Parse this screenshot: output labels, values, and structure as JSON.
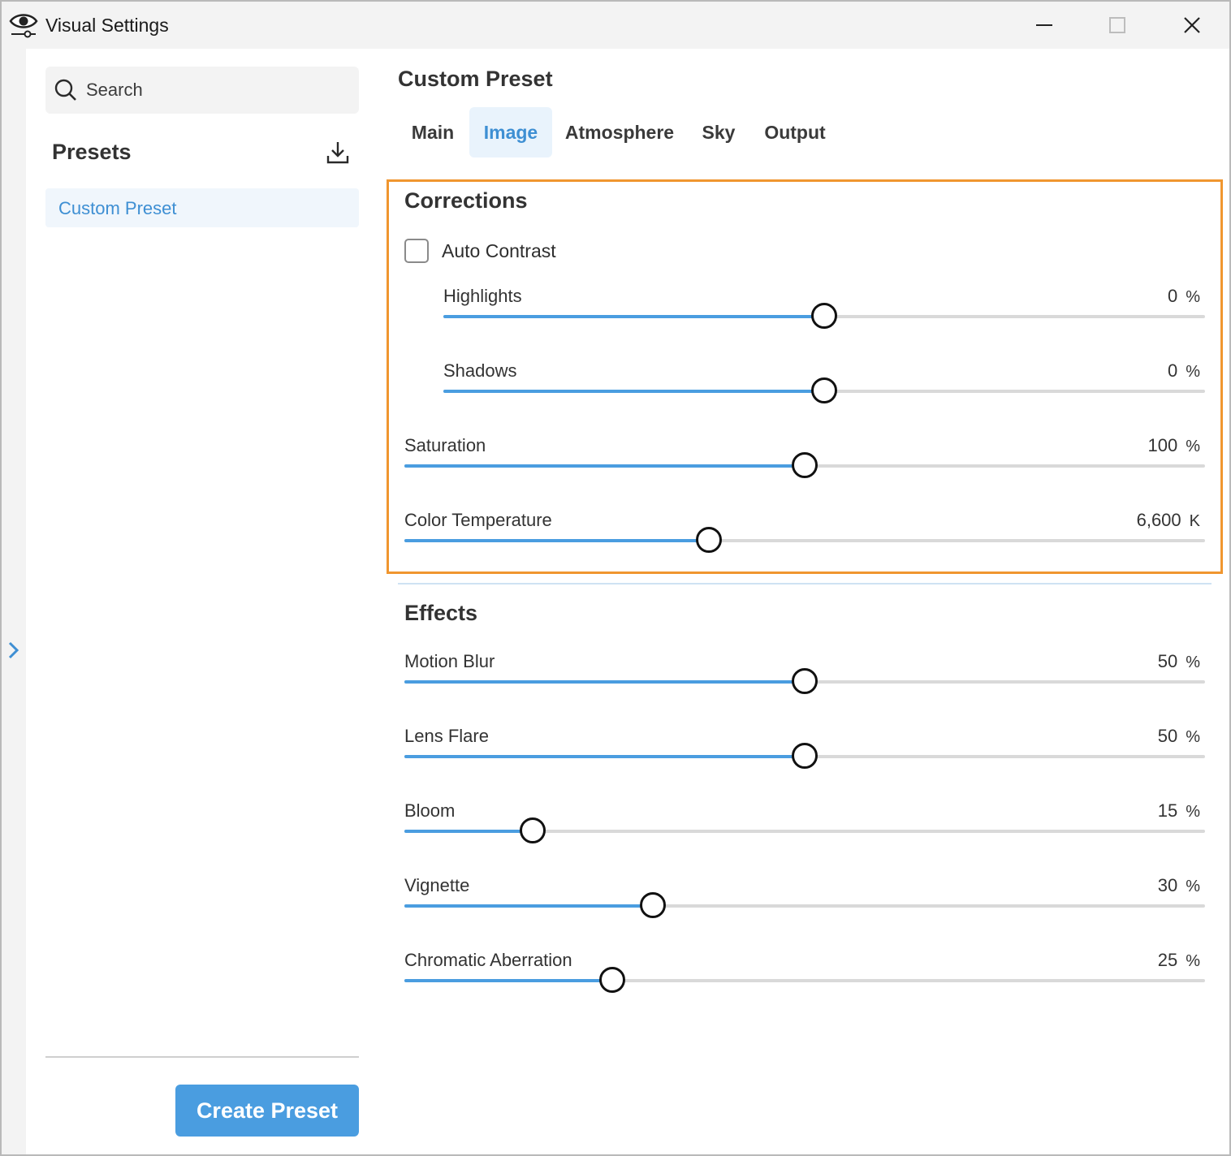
{
  "window": {
    "title": "Visual Settings",
    "app_icon": "eye-settings-icon",
    "controls": [
      "minimize-icon",
      "maximize-icon",
      "close-icon"
    ]
  },
  "sidebar": {
    "search_placeholder": "Search",
    "presets_title": "Presets",
    "download_icon": "download-icon",
    "items": [
      {
        "label": "Custom Preset",
        "selected": true
      }
    ],
    "create_button": "Create Preset",
    "expand_icon": "chevron-right-icon"
  },
  "main": {
    "title": "Custom Preset",
    "tabs": [
      {
        "label": "Main",
        "active": false
      },
      {
        "label": "Image",
        "active": true
      },
      {
        "label": "Atmosphere",
        "active": false
      },
      {
        "label": "Sky",
        "active": false
      },
      {
        "label": "Output",
        "active": false
      }
    ],
    "corrections": {
      "title": "Corrections",
      "auto_contrast": {
        "label": "Auto Contrast",
        "checked": false
      },
      "sliders": [
        {
          "label": "Highlights",
          "value": "0",
          "unit": "%",
          "fill_fraction": 0.5
        },
        {
          "label": "Shadows",
          "value": "0",
          "unit": "%",
          "fill_fraction": 0.5
        },
        {
          "label": "Saturation",
          "value": "100",
          "unit": "%",
          "fill_fraction": 0.5
        },
        {
          "label": "Color Temperature",
          "value": "6,600",
          "unit": "K",
          "fill_fraction": 0.38
        }
      ]
    },
    "effects": {
      "title": "Effects",
      "sliders": [
        {
          "label": "Motion Blur",
          "value": "50",
          "unit": "%",
          "fill_fraction": 0.5
        },
        {
          "label": "Lens Flare",
          "value": "50",
          "unit": "%",
          "fill_fraction": 0.5
        },
        {
          "label": "Bloom",
          "value": "15",
          "unit": "%",
          "fill_fraction": 0.16
        },
        {
          "label": "Vignette",
          "value": "30",
          "unit": "%",
          "fill_fraction": 0.31
        },
        {
          "label": "Chromatic Aberration",
          "value": "25",
          "unit": "%",
          "fill_fraction": 0.26
        }
      ]
    }
  },
  "colors": {
    "accent": "#4a9de0",
    "highlight_border": "#f0962f",
    "selected_text": "#3e8fd3"
  }
}
